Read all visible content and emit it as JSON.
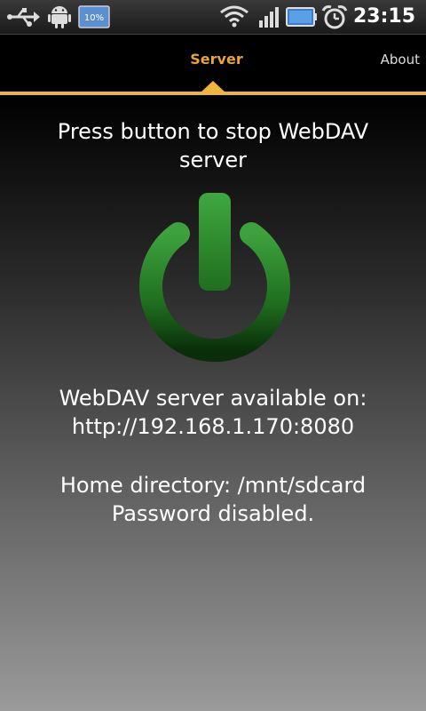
{
  "status_bar": {
    "time": "23:15",
    "icons": [
      "usb-icon",
      "android-debug-icon",
      "battery-percent-icon",
      "wifi-icon",
      "signal-icon",
      "battery-icon",
      "alarm-clock-icon"
    ],
    "battery_text": "10%"
  },
  "tabs": {
    "server_label": "Server",
    "about_label": "About"
  },
  "main": {
    "instruction_line1": "Press button to stop WebDAV",
    "instruction_line2": "server",
    "available_line1": "WebDAV server available on:",
    "available_line2": "http://192.168.1.170:8080",
    "home_directory": "Home directory: /mnt/sdcard",
    "password_status": "Password disabled."
  },
  "colors": {
    "accent": "#f0b43c",
    "power_green": "#2e8a2e"
  }
}
